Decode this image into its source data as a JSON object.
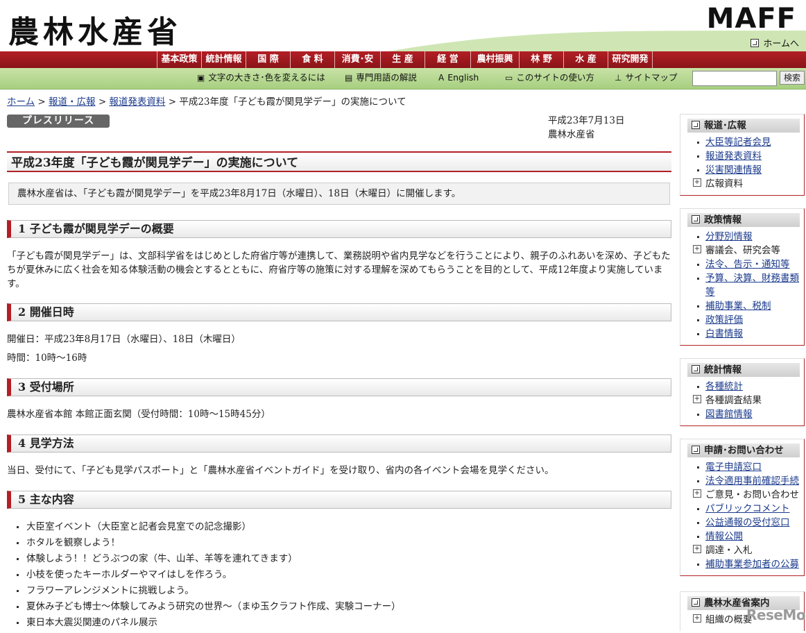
{
  "header": {
    "logo": "農林水産省",
    "maff": "MAFF",
    "home": "ホームへ"
  },
  "nav": [
    "基本政策",
    "統計情報",
    "国 際",
    "食 料",
    "消費･安全",
    "生 産",
    "経 営",
    "農村振興",
    "林 野",
    "水 産",
    "研究開発"
  ],
  "util": {
    "textsize": "文字の大きさ･色を変えるには",
    "glossary": "専門用語の解説",
    "english": "English",
    "howto": "このサイトの使い方",
    "sitemap": "サイトマップ",
    "search_button": "検索",
    "search_value": ""
  },
  "breadcrumb": {
    "home": "ホーム",
    "news": "報道・広報",
    "press": "報道発表資料",
    "current": "平成23年度「子ども霞が関見学デー」の実施について",
    "sep": ">"
  },
  "main": {
    "pill": "プレスリリース",
    "date": "平成23年7月13日",
    "ministry": "農林水産省",
    "title": "平成23年度「子ども霞が関見学デー」の実施について",
    "lead": "農林水産省は、「子ども霞が関見学デー」を平成23年8月17日（水曜日）、18日（木曜日）に開催します。",
    "s1": "1 子ども霞が関見学デーの概要",
    "p1": "「子ども霞が関見学デー」は、文部科学省をはじめとした府省庁等が連携して、業務説明や省内見学などを行うことにより、親子のふれあいを深め、子どもたちが夏休みに広く社会を知る体験活動の機会とするとともに、府省庁等の施策に対する理解を深めてもらうことを目的として、平成12年度より実施しています。",
    "s2": "2 開催日時",
    "p2a": "開催日：平成23年8月17日（水曜日）、18日（木曜日）",
    "p2b": "時間：10時～16時",
    "s3": "3 受付場所",
    "p3": "農林水産省本館 本館正面玄関（受付時間：10時～15時45分）",
    "s4": "4 見学方法",
    "p4": "当日、受付にて、「子ども見学パスポート」と「農林水産省イベントガイド」を受け取り、省内の各イベント会場を見学ください。",
    "s5": "5 主な内容",
    "items": [
      "大臣室イベント（大臣室と記者会見室での記念撮影）",
      "ホタルを観察しよう！",
      "体験しよう！！どうぶつの家（牛、山羊、羊等を連れてきます）",
      "小枝を使ったキーホルダーやマイはしを作ろう。",
      "フラワーアレンジメントに挑戦しよう。",
      "夏休み子ども博士～体験してみよう研究の世界～（まゆ玉クラフト作成、実験コーナー）",
      "東日本大震災関連のパネル展示"
    ]
  },
  "sidebar": [
    {
      "title": "報道･広報",
      "items": [
        {
          "label": "大臣等記者会見",
          "type": "link"
        },
        {
          "label": "報道発表資料",
          "type": "link"
        },
        {
          "label": "災害関連情報",
          "type": "link"
        },
        {
          "label": "広報資料",
          "type": "plus"
        }
      ]
    },
    {
      "title": "政策情報",
      "items": [
        {
          "label": "分野別情報",
          "type": "link"
        },
        {
          "label": "審議会、研究会等",
          "type": "plus"
        },
        {
          "label": "法令、告示・通知等",
          "type": "link"
        },
        {
          "label": "予算、決算、財務書類等",
          "type": "link"
        },
        {
          "label": "補助事業、税制",
          "type": "link"
        },
        {
          "label": "政策評価",
          "type": "link"
        },
        {
          "label": "白書情報",
          "type": "link"
        }
      ]
    },
    {
      "title": "統計情報",
      "items": [
        {
          "label": "各種統計",
          "type": "link"
        },
        {
          "label": "各種調査結果",
          "type": "plus"
        },
        {
          "label": "図書館情報",
          "type": "link"
        }
      ]
    },
    {
      "title": "申請･お問い合わせ",
      "items": [
        {
          "label": "電子申請窓口",
          "type": "link"
        },
        {
          "label": "法令適用事前確認手続",
          "type": "link"
        },
        {
          "label": "ご意見・お問い合わせ",
          "type": "plus"
        },
        {
          "label": "パブリックコメント",
          "type": "link"
        },
        {
          "label": "公益通報の受付窓口",
          "type": "link"
        },
        {
          "label": "情報公開",
          "type": "link"
        },
        {
          "label": "調達・入札",
          "type": "plus"
        },
        {
          "label": "補助事業参加者の公募",
          "type": "link"
        }
      ]
    },
    {
      "title": "農林水産省案内",
      "items": [
        {
          "label": "組織の概要",
          "type": "plus"
        }
      ]
    }
  ],
  "watermark": "ReseMom"
}
